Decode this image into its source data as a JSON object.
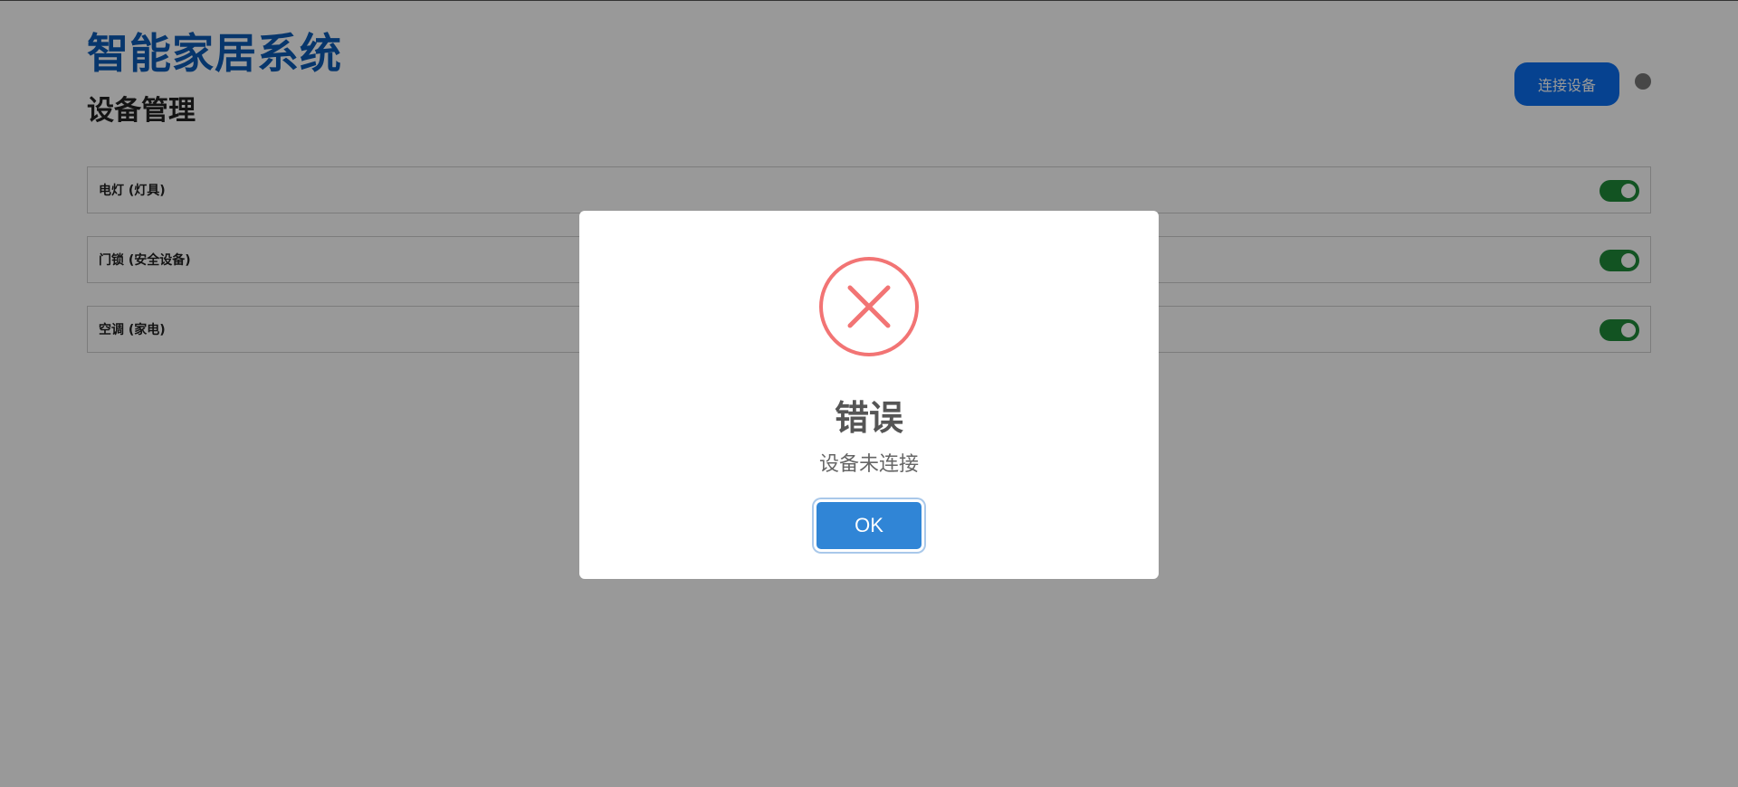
{
  "header": {
    "app_title": "智能家居系统",
    "section_title": "设备管理",
    "connect_button": "连接设备",
    "status_indicator": "disconnected"
  },
  "devices": [
    {
      "label": "电灯 (灯具)",
      "enabled": true
    },
    {
      "label": "门锁 (安全设备)",
      "enabled": true
    },
    {
      "label": "空调 (家电)",
      "enabled": true
    }
  ],
  "modal": {
    "icon": "error-x-icon",
    "title": "错误",
    "message": "设备未连接",
    "ok_label": "OK"
  },
  "colors": {
    "title_blue": "#0d5bb5",
    "button_blue": "#0b6ff0",
    "toggle_on": "#1e8a3a",
    "error_red": "#f27474",
    "ok_blue": "#3085d6"
  }
}
